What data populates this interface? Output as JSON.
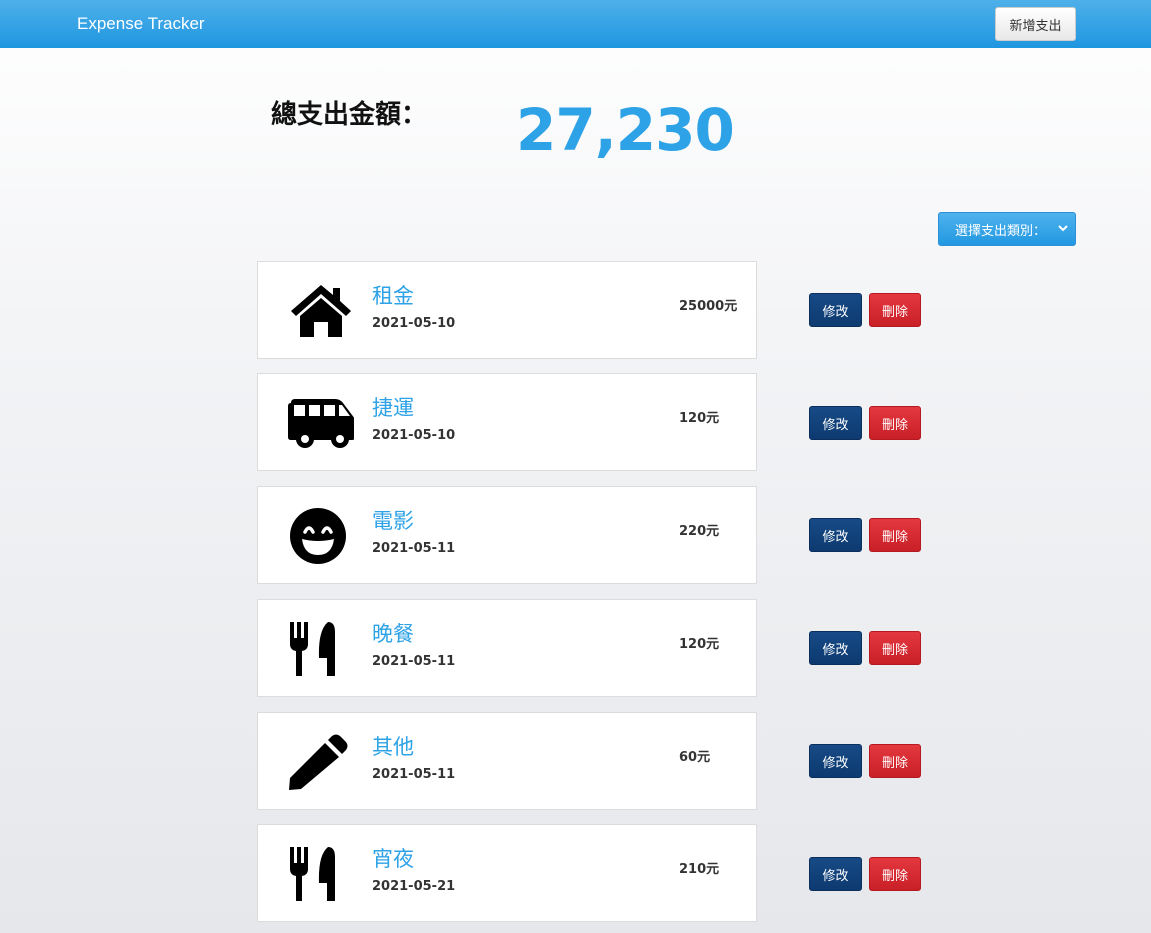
{
  "navbar": {
    "brand": "Expense Tracker",
    "add_button": "新增支出"
  },
  "summary": {
    "label": "總支出金額：",
    "total": "27,230"
  },
  "filter": {
    "placeholder": "選擇支出類別："
  },
  "colors": {
    "accent": "#2ea2e6",
    "edit": "#0d3a70",
    "delete": "#c91f27"
  },
  "records": [
    {
      "icon": "home-icon",
      "name": "租金",
      "date": "2021-05-10",
      "amount": "25000元"
    },
    {
      "icon": "shuttle-van-icon",
      "name": "捷運",
      "date": "2021-05-10",
      "amount": "120元"
    },
    {
      "icon": "grin-beam-icon",
      "name": "電影",
      "date": "2021-05-11",
      "amount": "220元"
    },
    {
      "icon": "utensils-icon",
      "name": "晚餐",
      "date": "2021-05-11",
      "amount": "120元"
    },
    {
      "icon": "pen-icon",
      "name": "其他",
      "date": "2021-05-11",
      "amount": "60元"
    },
    {
      "icon": "utensils-icon",
      "name": "宵夜",
      "date": "2021-05-21",
      "amount": "210元"
    }
  ],
  "actions": {
    "edit": "修改",
    "delete": "刪除"
  }
}
